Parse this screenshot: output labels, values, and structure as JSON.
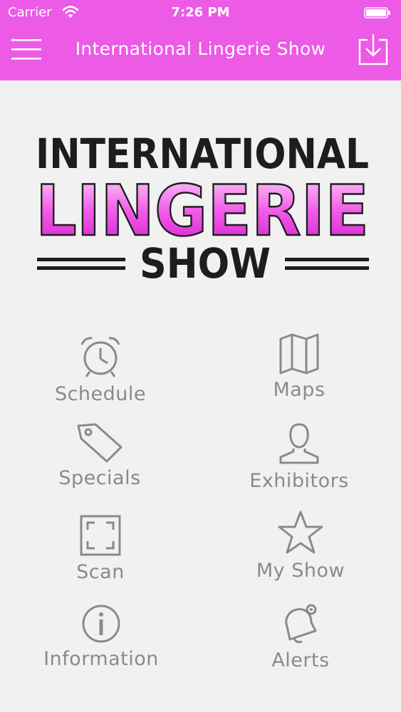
{
  "status_bar": {
    "carrier": "Carrier",
    "time": "7:26 PM"
  },
  "navbar": {
    "title": "International Lingerie Show",
    "menu_icon": "hamburger-menu-icon",
    "download_icon": "download-icon"
  },
  "logo": {
    "line1": "INTERNATIONAL",
    "line2": "LINGERIE",
    "line3": "SHOW"
  },
  "menu": {
    "items": [
      {
        "label": "Schedule",
        "icon": "alarm-clock-icon"
      },
      {
        "label": "Maps",
        "icon": "map-icon"
      },
      {
        "label": "Specials",
        "icon": "tag-icon"
      },
      {
        "label": "Exhibitors",
        "icon": "person-icon"
      },
      {
        "label": "Scan",
        "icon": "scan-frame-icon"
      },
      {
        "label": "My Show",
        "icon": "star-icon"
      },
      {
        "label": "Information",
        "icon": "info-icon"
      },
      {
        "label": "Alerts",
        "icon": "bell-icon"
      }
    ]
  },
  "colors": {
    "accent": "#ec5ae6",
    "icon_gray": "#8a8a8a",
    "background": "#f1f1f1"
  }
}
